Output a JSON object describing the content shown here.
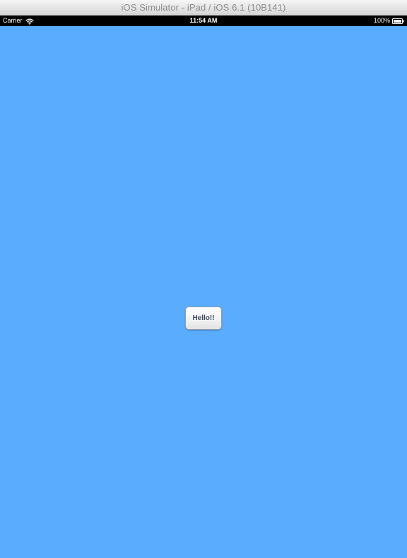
{
  "window": {
    "title": "iOS Simulator - iPad / iOS 6.1 (10B141)"
  },
  "status_bar": {
    "carrier": "Carrier",
    "time": "11:54 AM",
    "battery": "100%"
  },
  "main": {
    "button_label": "Hello!!",
    "background_color": "#5aacff"
  },
  "icons": {
    "signal": "wifi-icon",
    "battery": "battery-icon"
  }
}
